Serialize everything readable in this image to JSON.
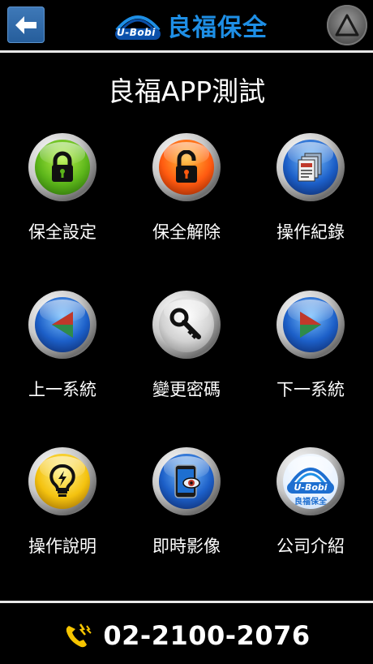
{
  "header": {
    "back_icon": "arrow-left-icon",
    "brand_logo_text": "U-Bobi",
    "brand_title": "良福保全",
    "menu_icon": "triangle-icon",
    "colors": {
      "brand": "#1e8fe6",
      "back_button": "#2f6aaa"
    }
  },
  "page": {
    "title": "良福APP測試"
  },
  "grid": [
    {
      "label": "保全設定",
      "icon": "lock-closed-icon",
      "color": "green"
    },
    {
      "label": "保全解除",
      "icon": "lock-open-icon",
      "color": "orange"
    },
    {
      "label": "操作紀錄",
      "icon": "documents-icon",
      "color": "blue"
    },
    {
      "label": "上一系統",
      "icon": "previous-icon",
      "color": "blue"
    },
    {
      "label": "變更密碼",
      "icon": "key-icon",
      "color": "silver"
    },
    {
      "label": "下一系統",
      "icon": "next-icon",
      "color": "blue"
    },
    {
      "label": "操作說明",
      "icon": "lightbulb-icon",
      "color": "yellow"
    },
    {
      "label": "即時影像",
      "icon": "tablet-camera-icon",
      "color": "blue"
    },
    {
      "label": "公司介紹",
      "icon": "company-logo-icon",
      "color": "white",
      "logo_text": "U-Bobi",
      "logo_subtext": "良福保全"
    }
  ],
  "footer": {
    "phone_icon": "phone-icon",
    "phone_number": "02-2100-2076",
    "phone_icon_color": "#f5c400"
  }
}
